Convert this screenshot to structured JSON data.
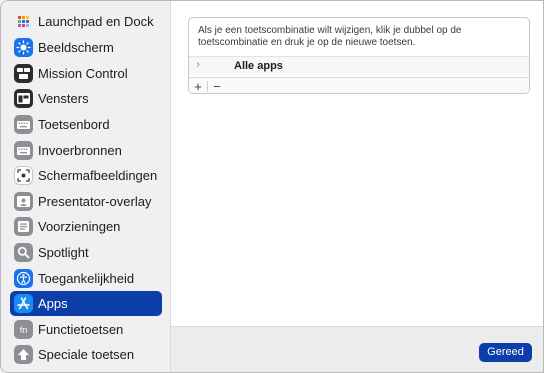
{
  "sidebar": {
    "items": [
      {
        "label": "Launchpad en Dock",
        "icon": "launchpad-icon",
        "color": "#ffffff"
      },
      {
        "label": "Beeldscherm",
        "icon": "display-icon",
        "color": "#1a73e8"
      },
      {
        "label": "Mission Control",
        "icon": "mission-control-icon",
        "color": "#2c2c2e"
      },
      {
        "label": "Vensters",
        "icon": "windows-icon",
        "color": "#2c2c2e"
      },
      {
        "label": "Toetsenbord",
        "icon": "keyboard-icon",
        "color": "#8e8e93"
      },
      {
        "label": "Invoerbronnen",
        "icon": "input-sources-icon",
        "color": "#8e8e93"
      },
      {
        "label": "Schermafbeeldingen",
        "icon": "screenshot-icon",
        "color": "#ffffff"
      },
      {
        "label": "Presentator-overlay",
        "icon": "presenter-overlay-icon",
        "color": "#8e8e93"
      },
      {
        "label": "Voorzieningen",
        "icon": "services-icon",
        "color": "#8e8e93"
      },
      {
        "label": "Spotlight",
        "icon": "spotlight-icon",
        "color": "#8e8e93"
      },
      {
        "label": "Toegankelijkheid",
        "icon": "accessibility-icon",
        "color": "#1a73e8"
      },
      {
        "label": "Apps",
        "icon": "app-store-icon",
        "color": "#1a73e8",
        "selected": true
      },
      {
        "label": "Functietoetsen",
        "icon": "function-keys-icon",
        "color": "#8e8e93"
      },
      {
        "label": "Speciale toetsen",
        "icon": "modifier-keys-icon",
        "color": "#8e8e93"
      }
    ]
  },
  "main": {
    "description": "Als je een toetscombinatie wilt wijzigen, klik je dubbel op de toetscombinatie en druk je op de nieuwe toetsen.",
    "row": {
      "chevron": "›",
      "label": "Alle apps"
    },
    "add_label": "+",
    "remove_label": "−"
  },
  "footer": {
    "done_label": "Gereed"
  },
  "colors": {
    "accent": "#0b3ea8",
    "sidebar_bg": "#f0eff1"
  }
}
